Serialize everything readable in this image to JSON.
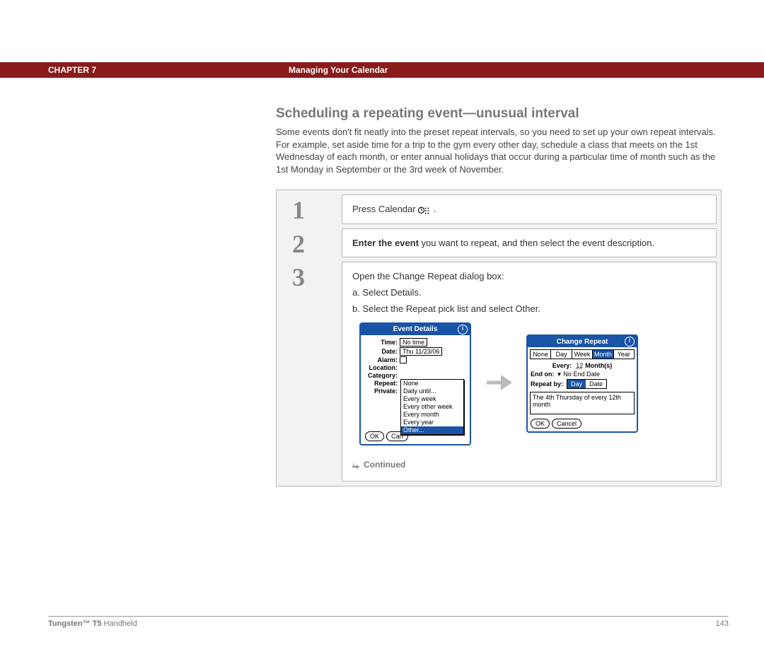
{
  "header": {
    "chapter": "CHAPTER 7",
    "title": "Managing Your Calendar"
  },
  "section": {
    "heading": "Scheduling a repeating event—unusual interval",
    "intro": "Some events don't fit neatly into the preset repeat intervals, so you need to set up your own repeat intervals. For example, set aside time for a trip to the gym every other day, schedule a class that meets on the 1st Wednesday of each month, or enter annual holidays that occur during a particular time of month such as the 1st Monday in September or the 3rd week of November."
  },
  "steps": {
    "one": {
      "num": "1",
      "text_pre": "Press Calendar ",
      "text_post": "."
    },
    "two": {
      "num": "2",
      "bold": "Enter the event",
      "rest": " you want to repeat, and then select the event description."
    },
    "three": {
      "num": "3",
      "line1": "Open the Change Repeat dialog box:",
      "a": "a.  Select Details.",
      "b": "b.  Select the Repeat pick list and select Other."
    }
  },
  "event_details": {
    "title": "Event Details",
    "rows": {
      "time_label": "Time:",
      "time_value": "No time",
      "date_label": "Date:",
      "date_value": "Thu 11/23/06",
      "alarm_label": "Alarm:",
      "location_label": "Location:",
      "category_label": "Category:",
      "repeat_label": "Repeat:",
      "private_label": "Private:"
    },
    "popup": {
      "opt1": "None",
      "opt2": "Daily until...",
      "opt3": "Every week",
      "opt4": "Every other week",
      "opt5": "Every month",
      "opt6": "Every year",
      "opt7": "Other..."
    },
    "buttons": {
      "ok": "OK",
      "cancel": "Can"
    }
  },
  "change_repeat": {
    "title": "Change Repeat",
    "tabs": {
      "t1": "None",
      "t2": "Day",
      "t3": "Week",
      "t4": "Month",
      "t5": "Year"
    },
    "every_label": "Every:",
    "every_value": "12",
    "every_unit": "Month(s)",
    "endon_label": "End on:",
    "endon_value": "No End Date",
    "repeatby_label": "Repeat by:",
    "repeatby_day": "Day",
    "repeatby_date": "Date",
    "summary": "The 4th Thursday of every 12th month",
    "buttons": {
      "ok": "OK",
      "cancel": "Cancel"
    }
  },
  "continued": "Continued",
  "footer": {
    "product_bold": "Tungsten™ T5",
    "product_rest": " Handheld",
    "page": "143"
  }
}
